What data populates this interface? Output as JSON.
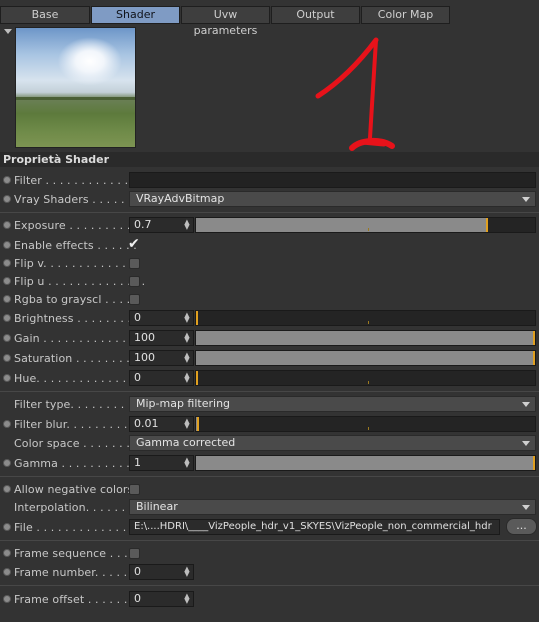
{
  "tabs": [
    "Base",
    "Shader",
    "Uvw parameters",
    "Output",
    "Color Map"
  ],
  "active_tab": "Shader",
  "annotation": {
    "mark_color": "#e8121a"
  },
  "section": {
    "title": "Proprietà Shader"
  },
  "rows": {
    "filter": {
      "label": "Filter . . . . . . . . . . . . . .",
      "value": ""
    },
    "vray_shaders": {
      "label": "Vray Shaders . . . . . . . .",
      "value": "VRayAdvBitmap"
    },
    "exposure": {
      "label": "Exposure . . . . . . . . . .",
      "value": "0.7",
      "slider_fraction": 0.86
    },
    "enable_effects": {
      "label": "Enable effects . . . . . .",
      "checked": true
    },
    "flip_v": {
      "label": "Flip v. . . . . . . . . . . . . .",
      "checked": false
    },
    "flip_u": {
      "label": "Flip u . . . . . . . . . . . . . .",
      "checked": false
    },
    "rgba_gray": {
      "label": "Rgba to grayscl . . . . .",
      "checked": false
    },
    "brightness": {
      "label": "Brightness . . . . . . . . .",
      "value": "0",
      "slider_fraction": 0.0
    },
    "gain": {
      "label": "Gain . . . . . . . . . . . . . .",
      "value": "100",
      "slider_fraction": 1.0
    },
    "saturation": {
      "label": "Saturation . . . . . . . . . .",
      "value": "100",
      "slider_fraction": 1.0
    },
    "hue": {
      "label": "Hue. . . . . . . . . . . . . . . .",
      "value": "0",
      "slider_fraction": 0.0
    },
    "filter_type": {
      "label": "Filter type. . . . . . . . .",
      "value": "Mip-map filtering"
    },
    "filter_blur": {
      "label": "Filter blur. . . . . . . . .",
      "value": "0.01",
      "slider_fraction": 0.01
    },
    "color_space": {
      "label": "Color space . . . . . . . .",
      "value": "Gamma corrected"
    },
    "gamma": {
      "label": "Gamma . . . . . . . . . . . .",
      "value": "1",
      "slider_fraction": 1.0
    },
    "allow_negative": {
      "label": "Allow negative colors",
      "checked": false
    },
    "interpolation": {
      "label": "Interpolation. . . . . . . .",
      "value": "Bilinear"
    },
    "file": {
      "label": "File . . . . . . . . . . . . . . .",
      "value": "E:\\....HDRI\\____VizPeople_hdr_v1_SKYES\\VizPeople_non_commercial_hdr",
      "browse": "..."
    },
    "frame_sequence": {
      "label": "Frame sequence . . . .",
      "checked": false
    },
    "frame_number": {
      "label": "Frame number. . . . . . .",
      "value": "0"
    },
    "frame_offset": {
      "label": "Frame offset . . . . . . .",
      "value": "0"
    }
  }
}
